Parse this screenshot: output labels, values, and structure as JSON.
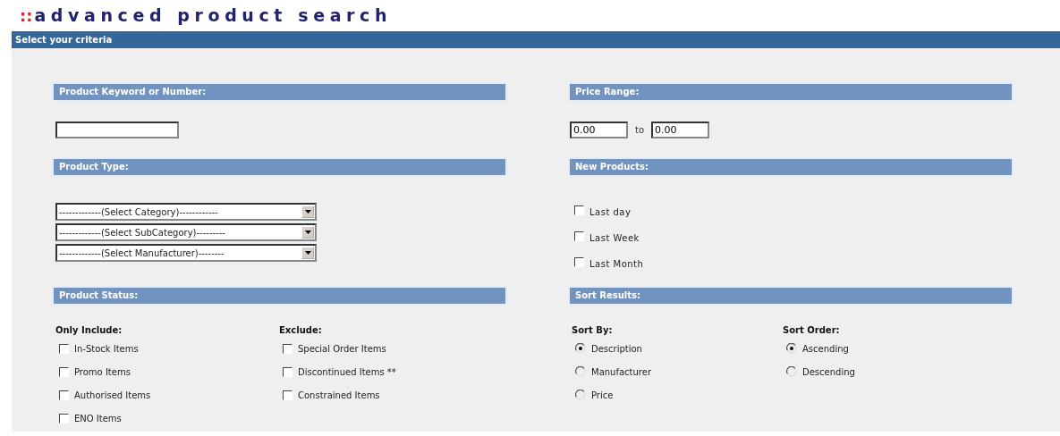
{
  "title_marker": "::",
  "title": "advanced product search",
  "criteria_bar": "Select your criteria",
  "keyword": {
    "heading": "Product Keyword or Number:"
  },
  "price_range": {
    "heading": "Price Range:",
    "from": "0.00",
    "to_label": "to",
    "to": "0.00"
  },
  "product_type": {
    "heading": "Product Type:",
    "selects": [
      "-------------(Select Category)------------",
      "-------------(Select SubCategory)---------",
      "-------------(Select Manufacturer)--------"
    ]
  },
  "new_products": {
    "heading": "New Products:",
    "options": [
      {
        "label": "Last day",
        "checked": false
      },
      {
        "label": "Last Week",
        "checked": false
      },
      {
        "label": "Last Month",
        "checked": false
      }
    ]
  },
  "product_status": {
    "heading": "Product Status:",
    "groups": [
      {
        "label": "Only Include:",
        "items": [
          {
            "label": "In-Stock Items",
            "checked": false
          },
          {
            "label": "Promo Items",
            "checked": false
          },
          {
            "label": "Authorised Items",
            "checked": false
          },
          {
            "label": "ENO Items",
            "checked": false
          }
        ]
      },
      {
        "label": "Exclude:",
        "items": [
          {
            "label": "Special Order Items",
            "checked": false
          },
          {
            "label": "Discontinued Items **",
            "checked": false
          },
          {
            "label": "Constrained Items",
            "checked": false
          }
        ]
      }
    ]
  },
  "sort_results": {
    "heading": "Sort Results:",
    "groups": [
      {
        "label": "Sort By:",
        "options": [
          {
            "label": "Description",
            "selected": true
          },
          {
            "label": "Manufacturer",
            "selected": false
          },
          {
            "label": "Price",
            "selected": false
          }
        ]
      },
      {
        "label": "Sort Order:",
        "options": [
          {
            "label": "Ascending",
            "selected": true
          },
          {
            "label": "Descending",
            "selected": false
          }
        ]
      }
    ]
  }
}
